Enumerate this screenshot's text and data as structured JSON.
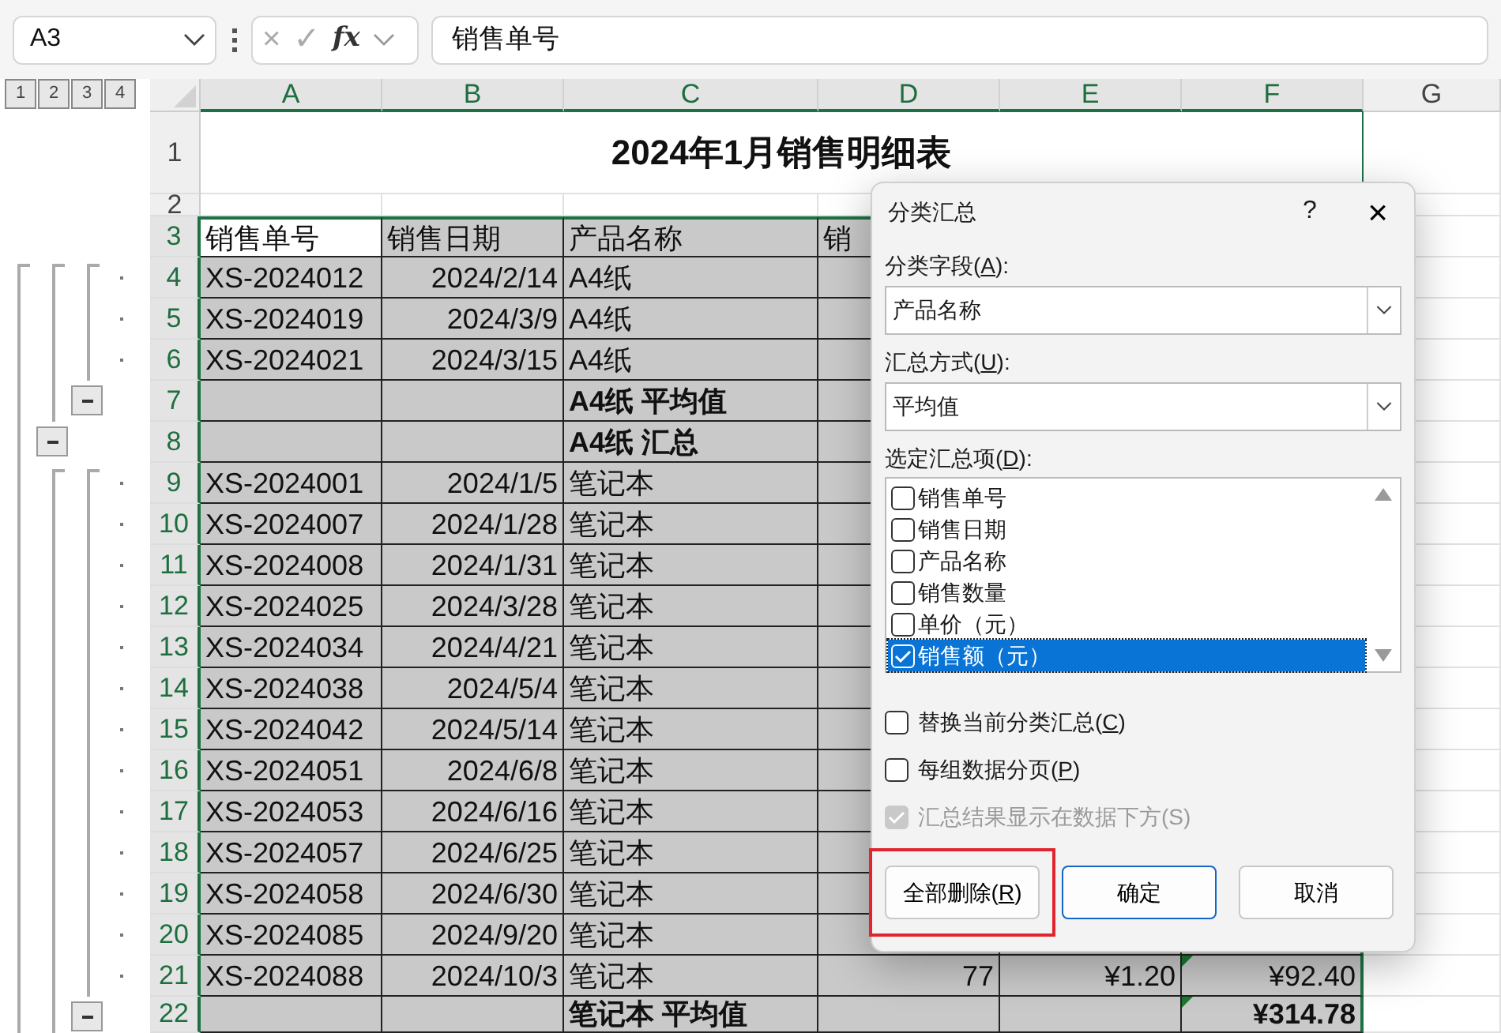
{
  "name_box": {
    "value": "A3"
  },
  "formula_bar": {
    "cancel": "×",
    "enter": "✓",
    "function": "fx",
    "value": "销售单号"
  },
  "outline_levels": [
    "1",
    "2",
    "3",
    "4"
  ],
  "columns": [
    {
      "label": "A",
      "selected": true
    },
    {
      "label": "B",
      "selected": true
    },
    {
      "label": "C",
      "selected": true
    },
    {
      "label": "D",
      "selected": true
    },
    {
      "label": "E",
      "selected": true
    },
    {
      "label": "F",
      "selected": true
    },
    {
      "label": "G",
      "selected": false
    }
  ],
  "rows": [
    {
      "number": "1",
      "kind": "title",
      "selected": false,
      "cells": [
        {
          "text": "2024年1月销售明细表"
        }
      ]
    },
    {
      "number": "2",
      "kind": "blank",
      "selected": false,
      "cells": []
    },
    {
      "number": "3",
      "kind": "header",
      "selected": true,
      "cells": [
        {
          "text": "销售单号",
          "active": true
        },
        {
          "text": "销售日期"
        },
        {
          "text": "产品名称"
        },
        {
          "text": "销"
        },
        {},
        {}
      ]
    },
    {
      "number": "4",
      "kind": "detail",
      "selected": true,
      "cells": [
        {
          "text": "XS-2024012"
        },
        {
          "text": "2024/2/14",
          "kind": "number"
        },
        {
          "text": "A4纸"
        },
        {},
        {},
        {}
      ]
    },
    {
      "number": "5",
      "kind": "detail",
      "selected": true,
      "cells": [
        {
          "text": "XS-2024019"
        },
        {
          "text": "2024/3/9",
          "kind": "number"
        },
        {
          "text": "A4纸"
        },
        {},
        {},
        {}
      ]
    },
    {
      "number": "6",
      "kind": "detail",
      "selected": true,
      "cells": [
        {
          "text": "XS-2024021"
        },
        {
          "text": "2024/3/15",
          "kind": "number"
        },
        {
          "text": "A4纸"
        },
        {},
        {},
        {}
      ]
    },
    {
      "number": "7",
      "kind": "average",
      "selected": true,
      "cells": [
        {},
        {},
        {
          "text": "A4纸 平均值"
        },
        {},
        {},
        {}
      ]
    },
    {
      "number": "8",
      "kind": "total",
      "selected": true,
      "cells": [
        {},
        {},
        {
          "text": "A4纸 汇总"
        },
        {},
        {},
        {}
      ]
    },
    {
      "number": "9",
      "kind": "detail",
      "selected": true,
      "cells": [
        {
          "text": "XS-2024001"
        },
        {
          "text": "2024/1/5",
          "kind": "number"
        },
        {
          "text": "笔记本"
        },
        {},
        {},
        {}
      ]
    },
    {
      "number": "10",
      "kind": "detail",
      "selected": true,
      "cells": [
        {
          "text": "XS-2024007"
        },
        {
          "text": "2024/1/28",
          "kind": "number"
        },
        {
          "text": "笔记本"
        },
        {},
        {},
        {}
      ]
    },
    {
      "number": "11",
      "kind": "detail",
      "selected": true,
      "cells": [
        {
          "text": "XS-2024008"
        },
        {
          "text": "2024/1/31",
          "kind": "number"
        },
        {
          "text": "笔记本"
        },
        {},
        {},
        {}
      ]
    },
    {
      "number": "12",
      "kind": "detail",
      "selected": true,
      "cells": [
        {
          "text": "XS-2024025"
        },
        {
          "text": "2024/3/28",
          "kind": "number"
        },
        {
          "text": "笔记本"
        },
        {},
        {},
        {}
      ]
    },
    {
      "number": "13",
      "kind": "detail",
      "selected": true,
      "cells": [
        {
          "text": "XS-2024034"
        },
        {
          "text": "2024/4/21",
          "kind": "number"
        },
        {
          "text": "笔记本"
        },
        {},
        {},
        {}
      ]
    },
    {
      "number": "14",
      "kind": "detail",
      "selected": true,
      "cells": [
        {
          "text": "XS-2024038"
        },
        {
          "text": "2024/5/4",
          "kind": "number"
        },
        {
          "text": "笔记本"
        },
        {},
        {},
        {}
      ]
    },
    {
      "number": "15",
      "kind": "detail",
      "selected": true,
      "cells": [
        {
          "text": "XS-2024042"
        },
        {
          "text": "2024/5/14",
          "kind": "number"
        },
        {
          "text": "笔记本"
        },
        {},
        {},
        {}
      ]
    },
    {
      "number": "16",
      "kind": "detail",
      "selected": true,
      "cells": [
        {
          "text": "XS-2024051"
        },
        {
          "text": "2024/6/8",
          "kind": "number"
        },
        {
          "text": "笔记本"
        },
        {},
        {},
        {}
      ]
    },
    {
      "number": "17",
      "kind": "detail",
      "selected": true,
      "cells": [
        {
          "text": "XS-2024053"
        },
        {
          "text": "2024/6/16",
          "kind": "number"
        },
        {
          "text": "笔记本"
        },
        {},
        {},
        {}
      ]
    },
    {
      "number": "18",
      "kind": "detail",
      "selected": true,
      "cells": [
        {
          "text": "XS-2024057"
        },
        {
          "text": "2024/6/25",
          "kind": "number"
        },
        {
          "text": "笔记本"
        },
        {},
        {},
        {}
      ]
    },
    {
      "number": "19",
      "kind": "detail",
      "selected": true,
      "cells": [
        {
          "text": "XS-2024058"
        },
        {
          "text": "2024/6/30",
          "kind": "number"
        },
        {
          "text": "笔记本"
        },
        {},
        {},
        {}
      ]
    },
    {
      "number": "20",
      "kind": "detail",
      "selected": true,
      "cells": [
        {
          "text": "XS-2024085"
        },
        {
          "text": "2024/9/20",
          "kind": "number"
        },
        {
          "text": "笔记本"
        },
        {},
        {},
        {}
      ]
    },
    {
      "number": "21",
      "kind": "detail",
      "selected": true,
      "cells": [
        {
          "text": "XS-2024088"
        },
        {
          "text": "2024/10/3",
          "kind": "number"
        },
        {
          "text": "笔记本"
        },
        {
          "text": "77",
          "kind": "number"
        },
        {
          "text": "¥1.20",
          "kind": "number"
        },
        {
          "text": "¥92.40",
          "kind": "number",
          "error_flag": true
        }
      ]
    },
    {
      "number": "22",
      "kind": "average",
      "selected": true,
      "cells": [
        {},
        {},
        {
          "text": "笔记本 平均值"
        },
        {},
        {},
        {
          "text": "¥314.78",
          "kind": "number",
          "error_flag": true
        }
      ]
    }
  ],
  "dialog": {
    "title": "分类汇总",
    "help": "?",
    "close": "×",
    "group_by": {
      "label_before": "分类字段(",
      "accesskey": "A",
      "label_after": "):",
      "value": "产品名称"
    },
    "function": {
      "label_before": "汇总方式(",
      "accesskey": "U",
      "label_after": "):",
      "value": "平均值"
    },
    "fields_label": {
      "label_before": "选定汇总项(",
      "accesskey": "D",
      "label_after": "):"
    },
    "fields": [
      {
        "label": "销售单号",
        "checked": false,
        "selected": false
      },
      {
        "label": "销售日期",
        "checked": false,
        "selected": false
      },
      {
        "label": "产品名称",
        "checked": false,
        "selected": false
      },
      {
        "label": "销售数量",
        "checked": false,
        "selected": false
      },
      {
        "label": "单价（元）",
        "checked": false,
        "selected": false
      },
      {
        "label": "销售额（元）",
        "checked": true,
        "selected": true
      }
    ],
    "options": [
      {
        "label_before": "替换当前分类汇总(",
        "accesskey": "C",
        "label_after": ")",
        "checked": false,
        "disabled": false
      },
      {
        "label_before": "每组数据分页(",
        "accesskey": "P",
        "label_after": ")",
        "checked": false,
        "disabled": false
      },
      {
        "label_before": "汇总结果显示在数据下方(S)",
        "checked": true,
        "disabled": true
      }
    ],
    "buttons": [
      {
        "label_before": "全部删除(",
        "accesskey": "R",
        "label_after": ")",
        "kind": "normal",
        "highlighted": true
      },
      {
        "label_before": "确定",
        "kind": "default",
        "highlighted": false
      },
      {
        "label_before": "取消",
        "kind": "normal",
        "highlighted": false
      }
    ]
  }
}
